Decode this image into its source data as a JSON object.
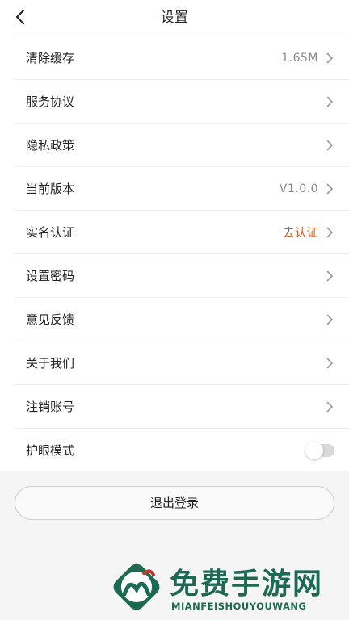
{
  "header": {
    "title": "设置",
    "back_icon": "chevron-left-icon"
  },
  "settings": [
    {
      "key": "clear-cache",
      "label": "清除缓存",
      "value": "1.65M"
    },
    {
      "key": "service-agreement",
      "label": "服务协议",
      "value": ""
    },
    {
      "key": "privacy-policy",
      "label": "隐私政策",
      "value": ""
    },
    {
      "key": "current-version",
      "label": "当前版本",
      "value": "V1.0.0"
    },
    {
      "key": "real-name-auth",
      "label": "实名认证",
      "value": "去认证"
    },
    {
      "key": "set-password",
      "label": "设置密码",
      "value": ""
    },
    {
      "key": "feedback",
      "label": "意见反馈",
      "value": ""
    },
    {
      "key": "about-us",
      "label": "关于我们",
      "value": ""
    },
    {
      "key": "cancel-account",
      "label": "注销账号",
      "value": ""
    }
  ],
  "eye_mode": {
    "label": "护眼模式",
    "enabled": false
  },
  "logout": {
    "label": "退出登录"
  },
  "watermark": {
    "title": "免费手游网",
    "subtitle": "MIANFEISHOUYOUWANG"
  },
  "colors": {
    "accent": "#d45a1c",
    "brand": "#1d6a52",
    "muted": "#888888"
  }
}
